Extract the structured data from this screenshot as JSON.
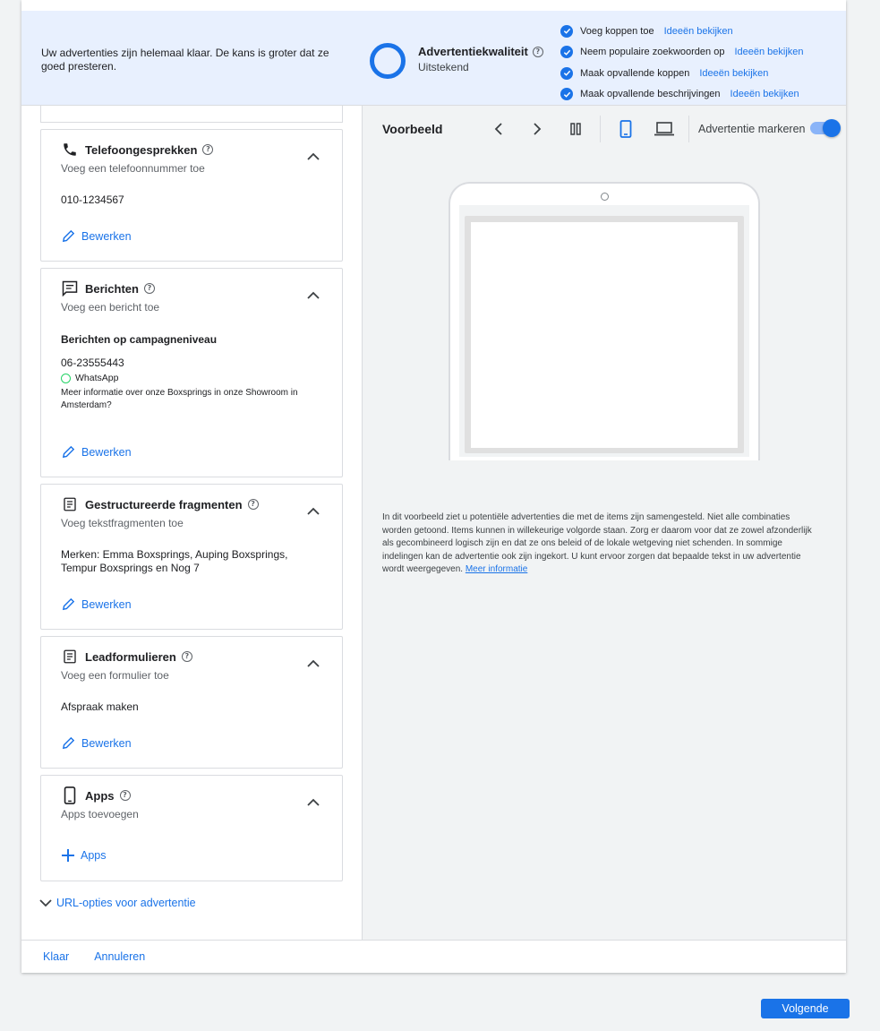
{
  "banner": {
    "message": "Uw advertenties zijn helemaal klaar. De kans is groter dat ze goed presteren.",
    "quality_title": "Advertentiekwaliteit",
    "quality_value": "Uitstekend",
    "checks": [
      {
        "label": "Voeg koppen toe",
        "link": "Ideeën bekijken"
      },
      {
        "label": "Neem populaire zoekwoorden op",
        "link": "Ideeën bekijken"
      },
      {
        "label": "Maak opvallende koppen",
        "link": "Ideeën bekijken"
      },
      {
        "label": "Maak opvallende beschrijvingen",
        "link": "Ideeën bekijken"
      }
    ]
  },
  "cards": {
    "phone": {
      "title": "Telefoongesprekken",
      "subtitle": "Voeg een telefoonnummer toe",
      "value": "010-1234567",
      "action": "Bewerken"
    },
    "messages": {
      "title": "Berichten",
      "subtitle": "Voeg een bericht toe",
      "heading": "Berichten op campagneniveau",
      "number": "06-23555443",
      "channel": "WhatsApp",
      "text": "Meer informatie over onze Boxsprings in onze Showroom in Amsterdam?",
      "action": "Bewerken"
    },
    "snippets": {
      "title": "Gestructureerde fragmenten",
      "subtitle": "Voeg tekstfragmenten toe",
      "value": "Merken: Emma Boxsprings, Auping Boxsprings, Tempur Boxsprings en Nog 7",
      "action": "Bewerken"
    },
    "leadforms": {
      "title": "Leadformulieren",
      "subtitle": "Voeg een formulier toe",
      "value": "Afspraak maken",
      "action": "Bewerken"
    },
    "apps": {
      "title": "Apps",
      "subtitle": "Apps toevoegen",
      "action": "Apps"
    }
  },
  "url_options": "URL-opties voor advertentie",
  "preview": {
    "title": "Voorbeeld",
    "highlight_label": "Advertentie markeren",
    "highlight_on": true,
    "disclaimer": "In dit voorbeeld ziet u potentiële advertenties die met de items zijn samengesteld. Niet alle combinaties worden getoond. Items kunnen in willekeurige volgorde staan. Zorg er daarom voor dat ze zowel afzonderlijk als gecombineerd logisch zijn en dat ze ons beleid of de lokale wetgeving niet schenden. In sommige indelingen kan de advertentie ook zijn ingekort. U kunt ervoor zorgen dat bepaalde tekst in uw advertentie wordt weergegeven.",
    "more_info": "Meer informatie"
  },
  "footer": {
    "done": "Klaar",
    "cancel": "Annuleren"
  },
  "next": "Volgende",
  "colors": {
    "accent": "#1a73e8",
    "banner_bg": "#e8f0fe",
    "whatsapp": "#25d366"
  }
}
